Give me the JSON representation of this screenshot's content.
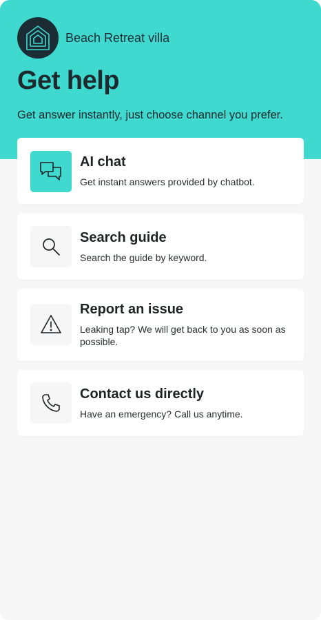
{
  "header": {
    "property_name": "Beach Retreat villa",
    "logo_icon": "house-icon",
    "title": "Get help",
    "subtitle": "Get answer instantly, just choose channel you prefer."
  },
  "options": [
    {
      "icon": "chat-bubbles-icon",
      "title": "AI chat",
      "description": "Get instant answers provided by chatbot."
    },
    {
      "icon": "search-icon",
      "title": "Search guide",
      "description": "Search the guide by keyword."
    },
    {
      "icon": "warning-icon",
      "title": "Report an issue",
      "description": "Leaking tap? We will get back to you as soon as possible."
    },
    {
      "icon": "phone-icon",
      "title": "Contact us directly",
      "description": "Have an emergency? Call us anytime."
    }
  ],
  "colors": {
    "accent": "#3fd9cf",
    "logo_bg": "#1c2c34",
    "background": "#f6f6f6",
    "card": "#ffffff"
  }
}
